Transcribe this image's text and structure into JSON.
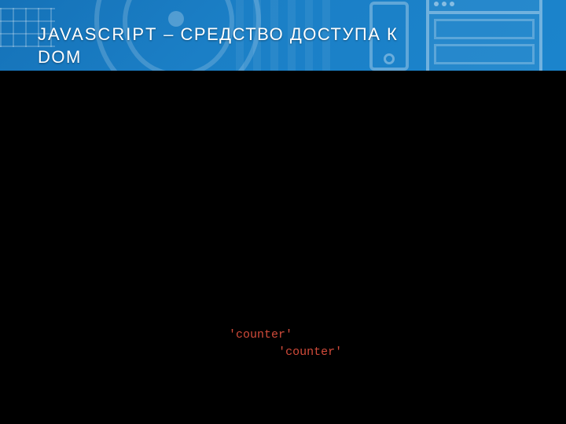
{
  "title": {
    "part1": "JAVASCRIPT",
    "dash": "–",
    "part2": "СРЕДСТВО ДОСТУПА К",
    "part3": "DOM"
  },
  "code": {
    "line1_str": "'counter'",
    "line2_str": "'counter'"
  }
}
